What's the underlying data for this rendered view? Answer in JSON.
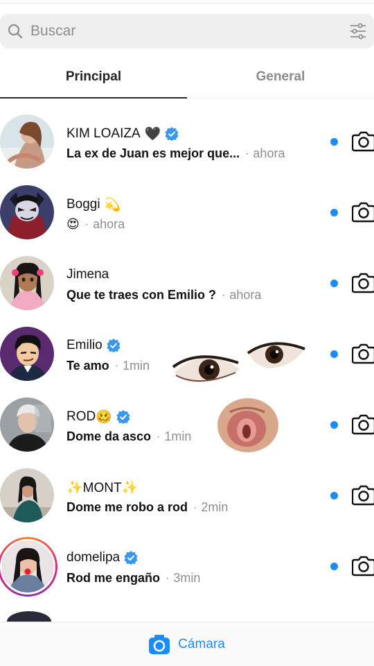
{
  "search": {
    "placeholder": "Buscar"
  },
  "tabs": [
    {
      "label": "Principal",
      "active": true
    },
    {
      "label": "General",
      "active": false
    }
  ],
  "conversations": [
    {
      "name": "KIM LOAIZA",
      "name_suffix": "🖤",
      "verified": true,
      "message": "La ex de Juan es mejor que...",
      "time": "ahora",
      "unread": true
    },
    {
      "name": "Boggi",
      "name_suffix": "💫",
      "verified": false,
      "message": "😍",
      "time": "ahora",
      "unread": true
    },
    {
      "name": "Jimena",
      "name_suffix": "",
      "verified": false,
      "message": "Que te traes con Emilio ?",
      "time": "ahora",
      "unread": true
    },
    {
      "name": "Emilio",
      "name_suffix": "",
      "verified": true,
      "message": "Te amo",
      "time": "1min",
      "unread": true
    },
    {
      "name": "ROD",
      "name_suffix": "🥴",
      "verified": true,
      "message": "Dome da asco",
      "time": "1min",
      "unread": true
    },
    {
      "name": "✨MONT✨",
      "name_suffix": "",
      "verified": false,
      "message": "Dome me robo a rod",
      "time": "2min",
      "unread": true
    },
    {
      "name": "domelipa",
      "name_suffix": "",
      "verified": true,
      "message": "Rod me engaño",
      "time": "3min",
      "unread": true
    }
  ],
  "bottom": {
    "camera_label": "Cámara"
  },
  "colors": {
    "accent": "#1a8cff",
    "verified": "#3897f0",
    "muted": "#8e8e8e"
  }
}
